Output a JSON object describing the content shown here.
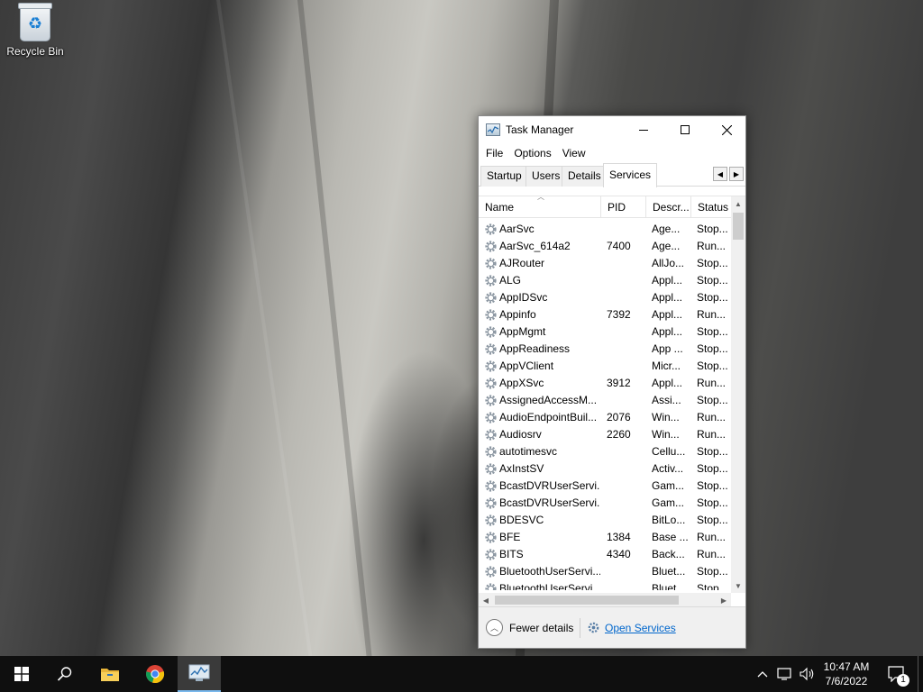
{
  "desktop": {
    "icons": [
      {
        "label": "Recycle Bin",
        "icon": "recycle-bin-icon"
      }
    ]
  },
  "window": {
    "title": "Task Manager",
    "controls": {
      "minimize": "minimize-icon",
      "maximize": "maximize-icon",
      "close": "close-icon"
    },
    "menu": [
      "File",
      "Options",
      "View"
    ],
    "tabs": [
      {
        "label": "Startup",
        "active": false
      },
      {
        "label": "Users",
        "active": false
      },
      {
        "label": "Details",
        "active": false
      },
      {
        "label": "Services",
        "active": true
      }
    ],
    "columns": [
      "Name",
      "PID",
      "Descr...",
      "Status"
    ],
    "services": [
      {
        "name": "AarSvc",
        "pid": "",
        "desc": "Age...",
        "status": "Stop..."
      },
      {
        "name": "AarSvc_614a2",
        "pid": "7400",
        "desc": "Age...",
        "status": "Run..."
      },
      {
        "name": "AJRouter",
        "pid": "",
        "desc": "AllJo...",
        "status": "Stop..."
      },
      {
        "name": "ALG",
        "pid": "",
        "desc": "Appl...",
        "status": "Stop..."
      },
      {
        "name": "AppIDSvc",
        "pid": "",
        "desc": "Appl...",
        "status": "Stop..."
      },
      {
        "name": "Appinfo",
        "pid": "7392",
        "desc": "Appl...",
        "status": "Run..."
      },
      {
        "name": "AppMgmt",
        "pid": "",
        "desc": "Appl...",
        "status": "Stop..."
      },
      {
        "name": "AppReadiness",
        "pid": "",
        "desc": "App ...",
        "status": "Stop..."
      },
      {
        "name": "AppVClient",
        "pid": "",
        "desc": "Micr...",
        "status": "Stop..."
      },
      {
        "name": "AppXSvc",
        "pid": "3912",
        "desc": "Appl...",
        "status": "Run..."
      },
      {
        "name": "AssignedAccessM...",
        "pid": "",
        "desc": "Assi...",
        "status": "Stop..."
      },
      {
        "name": "AudioEndpointBuil...",
        "pid": "2076",
        "desc": "Win...",
        "status": "Run..."
      },
      {
        "name": "Audiosrv",
        "pid": "2260",
        "desc": "Win...",
        "status": "Run..."
      },
      {
        "name": "autotimesvc",
        "pid": "",
        "desc": "Cellu...",
        "status": "Stop..."
      },
      {
        "name": "AxInstSV",
        "pid": "",
        "desc": "Activ...",
        "status": "Stop..."
      },
      {
        "name": "BcastDVRUserServi...",
        "pid": "",
        "desc": "Gam...",
        "status": "Stop..."
      },
      {
        "name": "BcastDVRUserServi...",
        "pid": "",
        "desc": "Gam...",
        "status": "Stop..."
      },
      {
        "name": "BDESVC",
        "pid": "",
        "desc": "BitLo...",
        "status": "Stop..."
      },
      {
        "name": "BFE",
        "pid": "1384",
        "desc": "Base ...",
        "status": "Run..."
      },
      {
        "name": "BITS",
        "pid": "4340",
        "desc": "Back...",
        "status": "Run..."
      },
      {
        "name": "BluetoothUserServi...",
        "pid": "",
        "desc": "Bluet...",
        "status": "Stop..."
      },
      {
        "name": "BluetoothUserServi...",
        "pid": "",
        "desc": "Bluet...",
        "status": "Stop..."
      }
    ],
    "footer": {
      "fewer_details": "Fewer details",
      "open_services": "Open Services"
    }
  },
  "taskbar": {
    "apps": [
      {
        "name": "start-button",
        "icon": "windows-logo-icon"
      },
      {
        "name": "search-button",
        "icon": "search-icon"
      },
      {
        "name": "file-explorer-button",
        "icon": "folder-icon"
      },
      {
        "name": "chrome-button",
        "icon": "chrome-icon"
      },
      {
        "name": "task-manager-button",
        "icon": "task-manager-icon",
        "active": true
      }
    ],
    "tray": {
      "time": "10:47 AM",
      "date": "7/6/2022",
      "notifications": "1"
    }
  },
  "colors": {
    "taskbar": "#0f0f0f",
    "link": "#0066cc",
    "active_taskbar_indicator": "#79b8ec"
  }
}
